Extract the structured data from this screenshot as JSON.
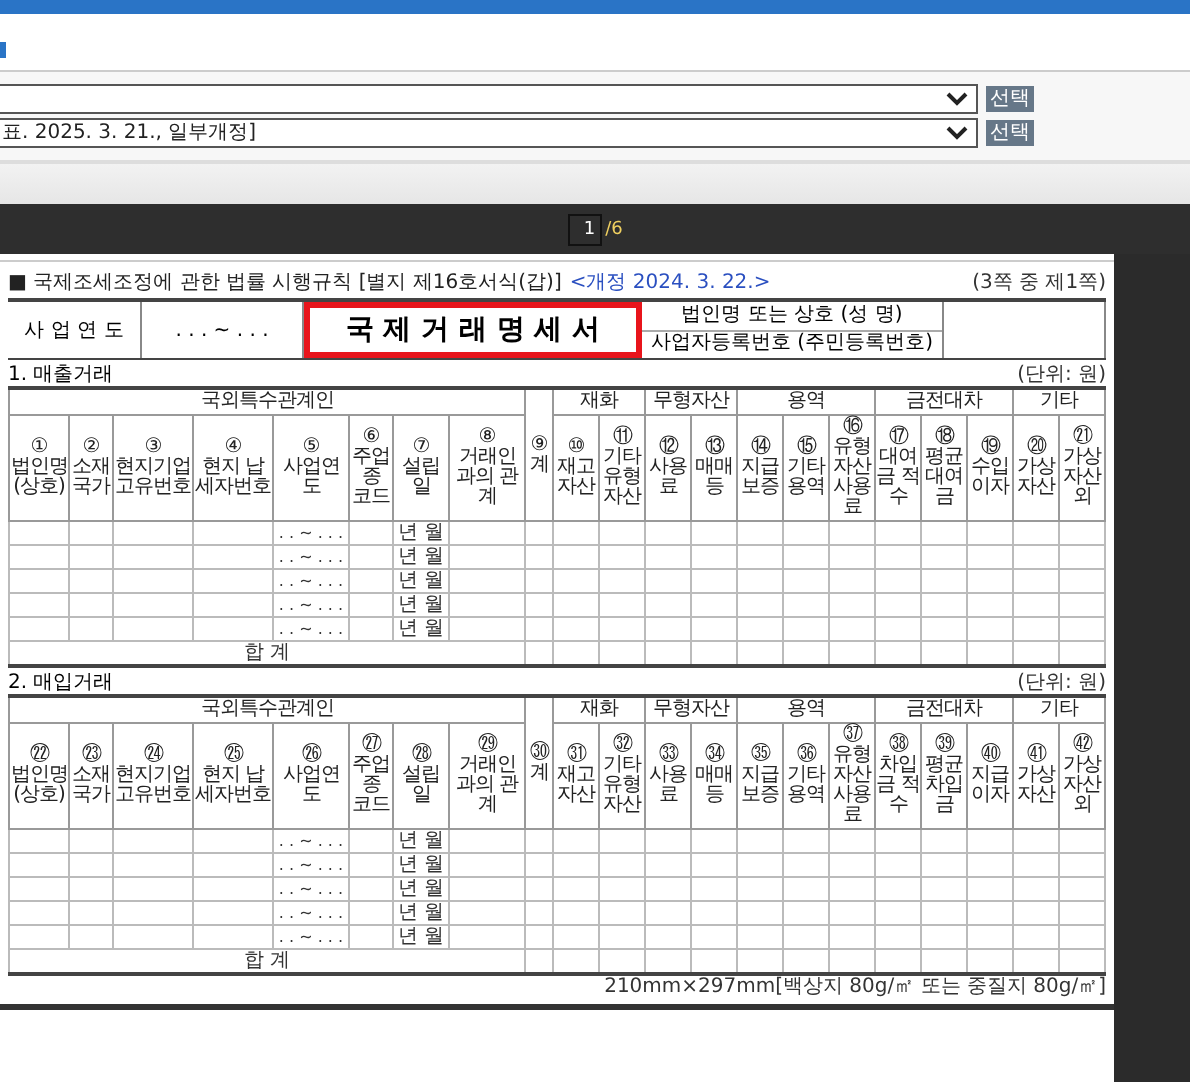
{
  "dropdowns": [
    {
      "button": "선택"
    },
    {
      "value": "표. 2025. 3. 21., 일부개정]",
      "button": "선택"
    }
  ],
  "viewer": {
    "page": "1",
    "total": "/6"
  },
  "form": {
    "note": "■ 국제조세조정에 관한 법률 시행규칙 [별지 제16호서식(갑)]",
    "amendment": "<개정 2024. 3. 22.>",
    "page_label": "(3쪽 중 제1쪽)",
    "year_label": "사 업 연 도",
    "year_value": ". . . ~ . . .",
    "title": {
      "text": "국 제 거 래 명 세 서",
      "highlighted": true
    },
    "id_labels": [
      "법인명 또는 상호 (성 명)",
      "사업자등록번호 (주민등록번호)"
    ],
    "sections": [
      {
        "title": "1. 매출거래",
        "unit": "(단위: 원)",
        "party_group": "국외특수관계인",
        "party_columns": [
          {
            "num": "①",
            "label": "법인명 (상호)"
          },
          {
            "num": "②",
            "label": "소재 국가"
          },
          {
            "num": "③",
            "label": "현지기업 고유번호"
          },
          {
            "num": "④",
            "label": "현지 납세자번호"
          },
          {
            "num": "⑤",
            "label": "사업연도"
          },
          {
            "num": "⑥",
            "label": "주업종 코드"
          },
          {
            "num": "⑦",
            "label": "설립일"
          },
          {
            "num": "⑧",
            "label": "거래인과의 관계"
          }
        ],
        "total_column": {
          "num": "⑨",
          "label": "계"
        },
        "groups": [
          {
            "label": "재화",
            "columns": [
              {
                "num": "⑩",
                "label": "재고 자산"
              },
              {
                "num": "⑪",
                "label": "기타 유형 자산"
              }
            ]
          },
          {
            "label": "무형자산",
            "columns": [
              {
                "num": "⑫",
                "label": "사용료"
              },
              {
                "num": "⑬",
                "label": "매매 등"
              }
            ]
          },
          {
            "label": "용역",
            "columns": [
              {
                "num": "⑭",
                "label": "지급 보증"
              },
              {
                "num": "⑮",
                "label": "기타 용역"
              },
              {
                "num": "⑯",
                "label": "유형 자산 사용료"
              }
            ]
          },
          {
            "label": "금전대차",
            "columns": [
              {
                "num": "⑰",
                "label": "대여금 적수"
              },
              {
                "num": "⑱",
                "label": "평균 대여금"
              },
              {
                "num": "⑲",
                "label": "수입 이자"
              }
            ]
          },
          {
            "label": "기타",
            "columns": [
              {
                "num": "⑳",
                "label": "가상 자산"
              },
              {
                "num": "㉑",
                "label": "가상 자산 외"
              }
            ]
          }
        ],
        "rows": [
          {
            "period": ". . ~ . . .",
            "established": "년 월"
          },
          {
            "period": ". . ~ . . .",
            "established": "년 월"
          },
          {
            "period": ". . ~ . . .",
            "established": "년 월"
          },
          {
            "period": ". . ~ . . .",
            "established": "년 월"
          },
          {
            "period": ". . ~ . . .",
            "established": "년 월"
          }
        ],
        "total_label": "합 계"
      },
      {
        "title": "2. 매입거래",
        "unit": "(단위: 원)",
        "party_group": "국외특수관계인",
        "party_columns": [
          {
            "num": "㉒",
            "label": "법인명 (상호)"
          },
          {
            "num": "㉓",
            "label": "소재 국가"
          },
          {
            "num": "㉔",
            "label": "현지기업 고유번호"
          },
          {
            "num": "㉕",
            "label": "현지 납세자번호"
          },
          {
            "num": "㉖",
            "label": "사업연도"
          },
          {
            "num": "㉗",
            "label": "주업종 코드"
          },
          {
            "num": "㉘",
            "label": "설립일"
          },
          {
            "num": "㉙",
            "label": "거래인과의 관계"
          }
        ],
        "total_column": {
          "num": "㉚",
          "label": "계"
        },
        "groups": [
          {
            "label": "재화",
            "columns": [
              {
                "num": "㉛",
                "label": "재고 자산"
              },
              {
                "num": "㉜",
                "label": "기타 유형 자산"
              }
            ]
          },
          {
            "label": "무형자산",
            "columns": [
              {
                "num": "㉝",
                "label": "사용료"
              },
              {
                "num": "㉞",
                "label": "매매 등"
              }
            ]
          },
          {
            "label": "용역",
            "columns": [
              {
                "num": "㉟",
                "label": "지급 보증"
              },
              {
                "num": "㊱",
                "label": "기타 용역"
              },
              {
                "num": "㊲",
                "label": "유형 자산 사용료"
              }
            ]
          },
          {
            "label": "금전대차",
            "columns": [
              {
                "num": "㊳",
                "label": "차입금 적수"
              },
              {
                "num": "㊴",
                "label": "평균 차입금"
              },
              {
                "num": "㊵",
                "label": "지급 이자"
              }
            ]
          },
          {
            "label": "기타",
            "columns": [
              {
                "num": "㊶",
                "label": "가상 자산"
              },
              {
                "num": "㊷",
                "label": "가상 자산 외"
              }
            ]
          }
        ],
        "rows": [
          {
            "period": ". . ~ . . .",
            "established": "년 월"
          },
          {
            "period": ". . ~ . . .",
            "established": "년 월"
          },
          {
            "period": ". . ~ . . .",
            "established": "년 월"
          },
          {
            "period": ". . ~ . . .",
            "established": "년 월"
          },
          {
            "period": ". . ~ . . .",
            "established": "년 월"
          }
        ],
        "total_label": "합 계"
      }
    ],
    "paper_size": "210mm×297mm[백상지 80g/㎡ 또는 중질지 80g/㎡]"
  }
}
